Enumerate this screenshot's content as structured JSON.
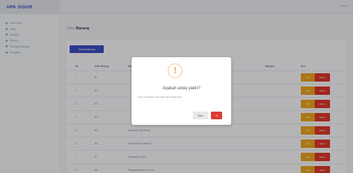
{
  "app": {
    "brand": "APK SISOR"
  },
  "sidebar": {
    "items": [
      {
        "label": "Dashboard"
      },
      {
        "label": "Jenis"
      },
      {
        "label": "Kategori"
      },
      {
        "label": "Barang"
      },
      {
        "label": "Transaksi Barang"
      },
      {
        "label": "Pengguna"
      }
    ]
  },
  "topbar": {
    "user": "Admin"
  },
  "page": {
    "title_prefix": "Data",
    "title": "Barang"
  },
  "add_button": "Tambah Barang",
  "table": {
    "headers": [
      "No",
      "Kode Barang",
      "Nama Barang",
      "Kategori",
      "Aksi"
    ],
    "rows": [
      {
        "no": "1",
        "code": "B1",
        "name": ""
      },
      {
        "no": "2",
        "code": "B2",
        "name": ""
      },
      {
        "no": "3",
        "code": "B3",
        "name": ""
      },
      {
        "no": "4",
        "code": "B4",
        "name": ""
      },
      {
        "no": "5",
        "code": "B5",
        "name": "Buku tulis Sinar Dunia"
      },
      {
        "no": "6",
        "code": "B6",
        "name": "Pensil Faber Castell 2B"
      },
      {
        "no": "7",
        "code": "B7",
        "name": "Penghapus Joyko"
      },
      {
        "no": "8",
        "code": "B8",
        "name": "Penggaris Butterfly 30 cm"
      }
    ],
    "edit_label": "Edit",
    "delete_label": "Hapus"
  },
  "modal": {
    "icon": "warning-icon",
    "title": "Apakah anda yakin?",
    "text": "Data yang dihapus tidak dapat dikembalikan lagi!",
    "cancel": "Batal",
    "confirm": "Ya"
  },
  "colors": {
    "primary": "#3b4ec0",
    "warning": "#e8a11f",
    "danger": "#d9362b"
  }
}
